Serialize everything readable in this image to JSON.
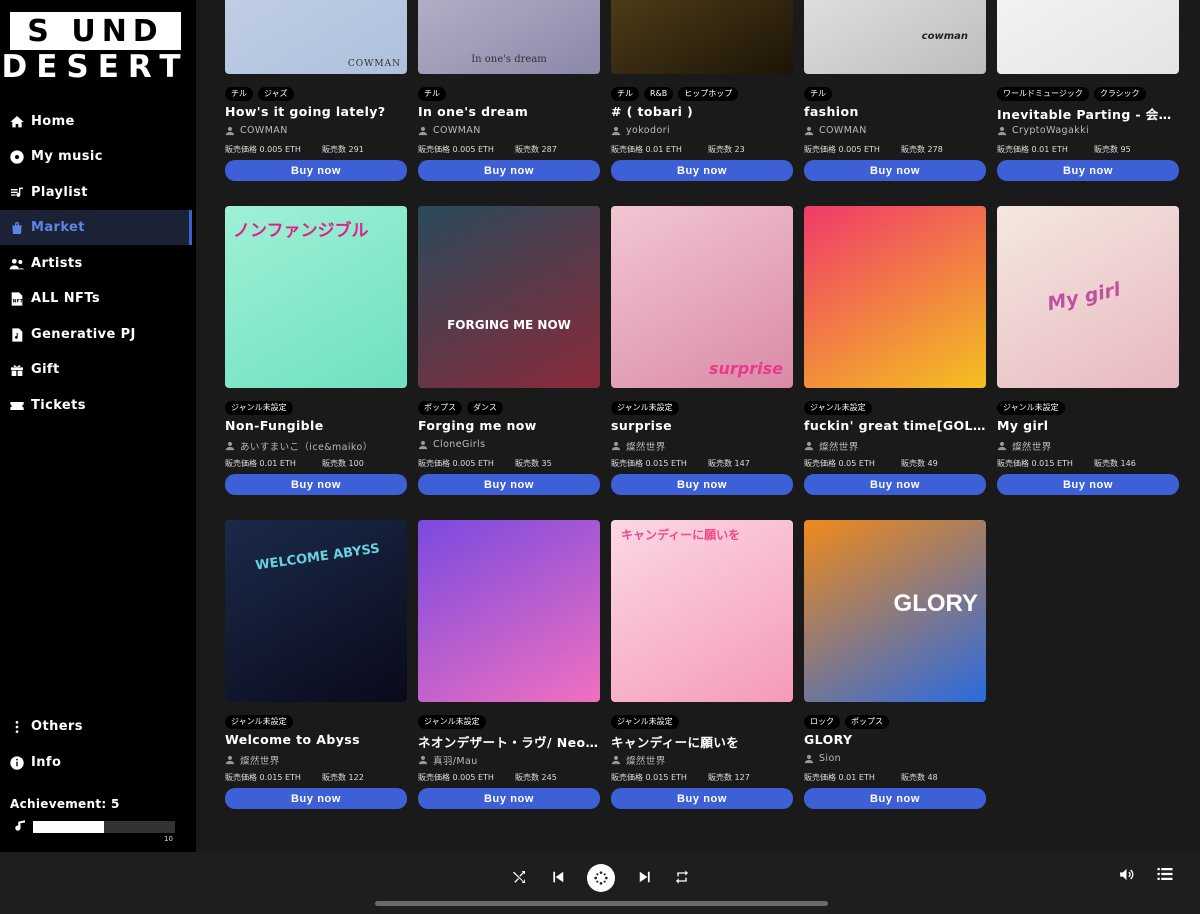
{
  "logo": {
    "line1": "S UND",
    "line2": "DESERT"
  },
  "nav": [
    {
      "label": "Home",
      "icon": "home-icon"
    },
    {
      "label": "My music",
      "icon": "disc-icon"
    },
    {
      "label": "Playlist",
      "icon": "playlist-icon"
    },
    {
      "label": "Market",
      "icon": "bag-icon",
      "active": true
    },
    {
      "label": "Artists",
      "icon": "users-icon"
    },
    {
      "label": "ALL NFTs",
      "icon": "nft-icon"
    },
    {
      "label": "Generative PJ",
      "icon": "music-file-icon"
    },
    {
      "label": "Gift",
      "icon": "gift-icon"
    },
    {
      "label": "Tickets",
      "icon": "ticket-icon"
    }
  ],
  "nav_bottom": [
    {
      "label": "Others",
      "icon": "more-vertical-icon"
    },
    {
      "label": "Info",
      "icon": "info-icon"
    }
  ],
  "achievement": {
    "label": "Achievement: 5",
    "value": 5,
    "max": 10,
    "max_label": "10"
  },
  "cards": [
    {
      "tags": [
        "チル",
        "ジャズ"
      ],
      "title": "How's it going lately?",
      "artist": "COWMAN",
      "price": "販売価格 0.005 ETH",
      "sold": "販売数 291",
      "buy": "Buy now",
      "art_text": "COWMAN",
      "colors": [
        "#c9d6ea",
        "#aec0dc"
      ]
    },
    {
      "tags": [
        "チル"
      ],
      "title": "In one's dream",
      "artist": "COWMAN",
      "price": "販売価格 0.005 ETH",
      "sold": "販売数 287",
      "buy": "Buy now",
      "art_text": "In one's dream",
      "colors": [
        "#c8c6d6",
        "#8a88a8"
      ]
    },
    {
      "tags": [
        "チル",
        "R&B",
        "ヒップホップ"
      ],
      "title": "# ( tobari )",
      "artist": "yokodori",
      "price": "販売価格 0.01 ETH",
      "sold": "販売数 23",
      "buy": "Buy now",
      "art_text": "",
      "colors": [
        "#6b5320",
        "#1c1408"
      ]
    },
    {
      "tags": [
        "チル"
      ],
      "title": "fashion",
      "artist": "COWMAN",
      "price": "販売価格 0.005 ETH",
      "sold": "販売数 278",
      "buy": "Buy now",
      "art_text": "cowman",
      "colors": [
        "#f2f2f2",
        "#bdbdbd"
      ]
    },
    {
      "tags": [
        "ワールドミュージック",
        "クラシック"
      ],
      "title": "Inevitable Parting - 会者定離 -",
      "artist": "CryptoWagakki",
      "price": "販売価格 0.01 ETH",
      "sold": "販売数 95",
      "buy": "Buy now",
      "art_text": "",
      "colors": [
        "#fbfbfb",
        "#e4e4e4"
      ]
    },
    {
      "tags": [
        "ジャンル未設定"
      ],
      "title": "Non-Fungible",
      "artist": "あいすまいこ（ice&maiko）",
      "price": "販売価格 0.01 ETH",
      "sold": "販売数 100",
      "buy": "Buy now",
      "art_text": "ノンファンジブル",
      "colors": [
        "#9ff0d6",
        "#6fe0c0"
      ]
    },
    {
      "tags": [
        "ポップス",
        "ダンス"
      ],
      "title": "Forging me now",
      "artist": "CloneGirls",
      "price": "販売価格 0.005 ETH",
      "sold": "販売数 35",
      "buy": "Buy now",
      "art_text": "FORGING ME NOW",
      "colors": [
        "#2a4a5a",
        "#8a2a3a"
      ]
    },
    {
      "tags": [
        "ジャンル未設定"
      ],
      "title": "surprise",
      "artist": "燦然世界",
      "price": "販売価格 0.015 ETH",
      "sold": "販売数 147",
      "buy": "Buy now",
      "art_text": "surprise",
      "colors": [
        "#f2c6d2",
        "#d98aa6"
      ]
    },
    {
      "tags": [
        "ジャンル未設定"
      ],
      "title": "fuckin' great time[GOLD Edition]",
      "artist": "燦然世界",
      "price": "販売価格 0.05 ETH",
      "sold": "販売数 49",
      "buy": "Buy now",
      "art_text": "",
      "colors": [
        "#f03a6a",
        "#f4c020"
      ]
    },
    {
      "tags": [
        "ジャンル未設定"
      ],
      "title": "My girl",
      "artist": "燦然世界",
      "price": "販売価格 0.015 ETH",
      "sold": "販売数 146",
      "buy": "Buy now",
      "art_text": "My girl",
      "colors": [
        "#f4e8e0",
        "#e8b8c0"
      ]
    },
    {
      "tags": [
        "ジャンル未設定"
      ],
      "title": "Welcome to Abyss",
      "artist": "燦然世界",
      "price": "販売価格 0.015 ETH",
      "sold": "販売数 122",
      "buy": "Buy now",
      "art_text": "WELCOME ABYSS",
      "colors": [
        "#1a2a4a",
        "#0a0a1a"
      ]
    },
    {
      "tags": [
        "ジャンル未設定"
      ],
      "title": "ネオンデザート・ラヴ/ Neon Desert Love",
      "artist": "真羽/Mau",
      "price": "販売価格 0.005 ETH",
      "sold": "販売数 245",
      "buy": "Buy now",
      "art_text": "",
      "colors": [
        "#7a4ae0",
        "#f070c0"
      ]
    },
    {
      "tags": [
        "ジャンル未設定"
      ],
      "title": "キャンディーに願いを",
      "artist": "燦然世界",
      "price": "販売価格 0.015 ETH",
      "sold": "販売数 127",
      "buy": "Buy now",
      "art_text": "キャンディーに願いを",
      "colors": [
        "#fbd8e4",
        "#f59ab8"
      ]
    },
    {
      "tags": [
        "ロック",
        "ポップス"
      ],
      "title": "GLORY",
      "artist": "Sion",
      "price": "販売価格 0.01 ETH",
      "sold": "販売数 48",
      "buy": "Buy now",
      "art_text": "GLORY",
      "colors": [
        "#f08a1a",
        "#2a6ae0"
      ]
    }
  ],
  "player": {
    "controls": [
      "shuffle-icon",
      "previous-icon",
      "play-icon",
      "next-icon",
      "repeat-icon"
    ],
    "right": [
      "volume-icon",
      "queue-icon"
    ]
  }
}
